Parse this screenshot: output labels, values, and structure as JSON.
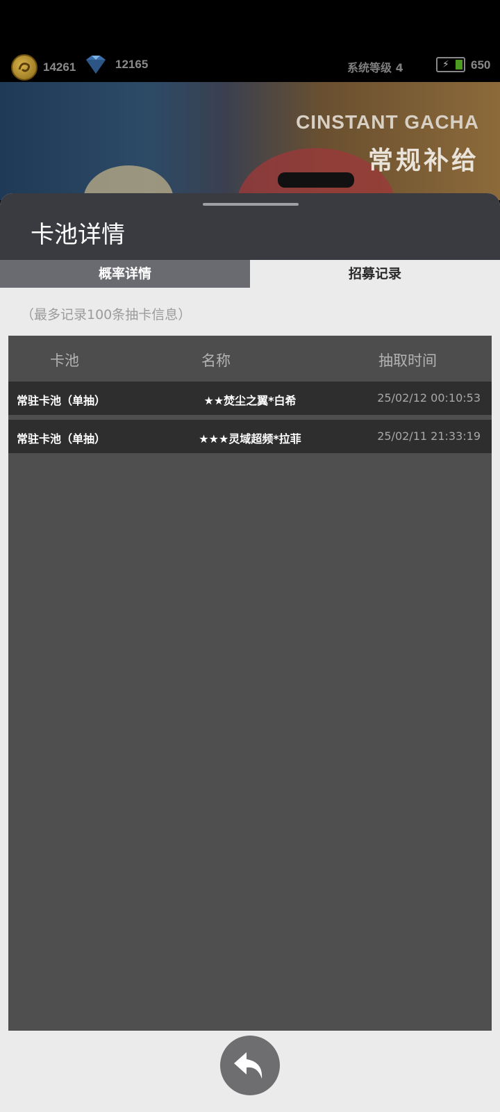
{
  "topbar": {
    "coins": "14261",
    "gems": "12165",
    "system_level": "系统等级 4",
    "energy": "650"
  },
  "banner": {
    "title_en": "CINSTANT GACHA",
    "title_cn": "常规补给"
  },
  "sheet": {
    "title": "卡池详情",
    "tabs": [
      {
        "label": "概率详情",
        "active": false
      },
      {
        "label": "招募记录",
        "active": true
      }
    ],
    "note": "（最多记录100条抽卡信息）",
    "table": {
      "headers": [
        "卡池",
        "名称",
        "抽取时间"
      ],
      "rows": [
        {
          "pool": "常驻卡池（单抽）",
          "name": "★★焚尘之翼*白希",
          "time": "25/02/12 00:10:53"
        },
        {
          "pool": "常驻卡池（单抽）",
          "name": "★★★灵域超频*拉菲",
          "time": "25/02/11 21:33:19"
        }
      ]
    }
  },
  "colors": {
    "sheet_header": "#3a3b41",
    "tab_inactive": "#6a6b71",
    "table_bg": "#4f4f4f",
    "row_bg": "#2e2e2e"
  },
  "icons": {
    "coin": "coin-icon",
    "gem": "gem-icon",
    "battery": "battery-icon",
    "back": "back-arrow-icon"
  }
}
